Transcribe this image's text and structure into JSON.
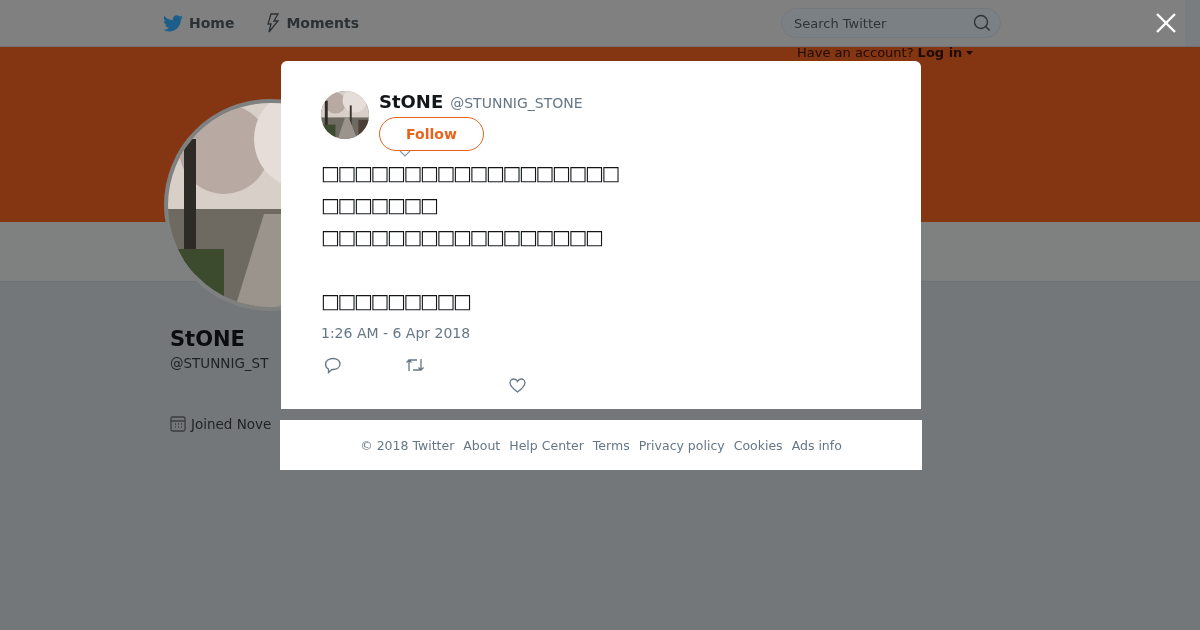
{
  "nav": {
    "items": [
      {
        "label": "Home",
        "kind": "bird"
      },
      {
        "label": "Moments",
        "kind": "bolt"
      }
    ]
  },
  "search": {
    "placeholder": "Search Twitter"
  },
  "login_prompt": {
    "text": "Have an account?",
    "link": "Log in"
  },
  "profile": {
    "name": "StONE",
    "handle": "@STUNNIG_ST",
    "joined": "Joined Nove"
  },
  "tweet": {
    "name": "StONE",
    "handle": "@STUNNIG_STONE",
    "follow": "Follow",
    "text": "□□□□□□□□□□□□□□□□□□\n□□□□□□□\n□□□□□□□□□□□□□□□□□\n\n□□□□□□□□□",
    "timestamp": "1:26 AM - 6 Apr 2018"
  },
  "footer": {
    "links": [
      "© 2018 Twitter",
      "About",
      "Help Center",
      "Terms",
      "Privacy policy",
      "Cookies",
      "Ads info"
    ]
  }
}
